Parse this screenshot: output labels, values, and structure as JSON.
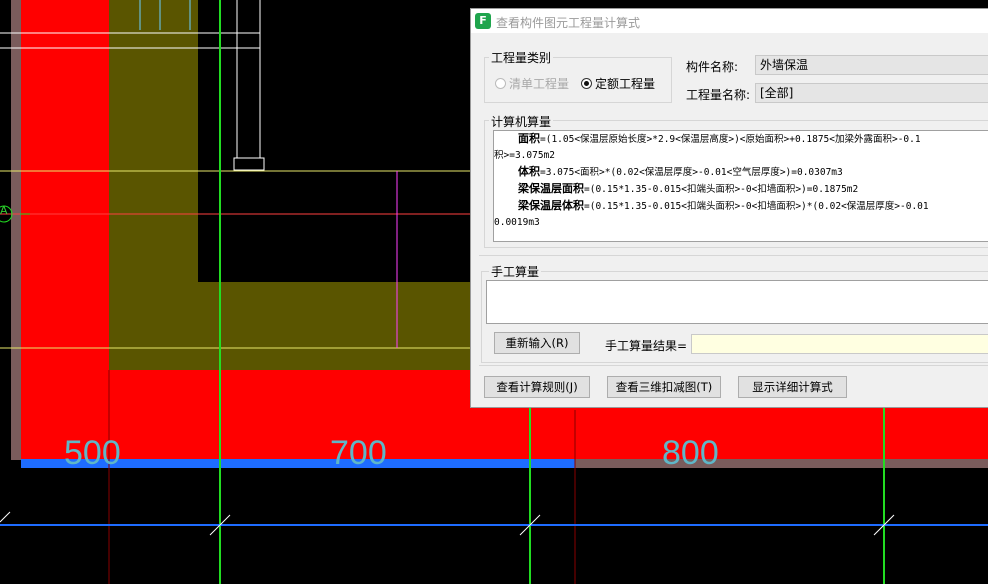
{
  "cad": {
    "dimensions": [
      "500",
      "700",
      "800"
    ],
    "axis_label": "A"
  },
  "dialog": {
    "title": "查看构件图元工程量计算式",
    "quantity_type_group": "工程量类别",
    "radio_list_quantity": "清单工程量",
    "radio_quota_quantity": "定额工程量",
    "radio_selected": "定额工程量",
    "component_name_label": "构件名称:",
    "component_name_value": "外墙保温",
    "quantity_name_label": "工程量名称:",
    "quantity_name_value": "[全部]",
    "computer_calc_group": "计算机算量",
    "calc_lines": [
      {
        "name": "面积",
        "expr": "=(1.05<保温层原始长度>*2.9<保温层高度>)<原始面积>+0.1875<加梁外露面积>-0.1",
        "indent": true
      },
      {
        "name": "",
        "expr": "积>=3.075m2",
        "indent": false
      },
      {
        "name": "体积",
        "expr": "=3.075<面积>*(0.02<保温层厚度>-0.01<空气层厚度>)=0.0307m3",
        "indent": true
      },
      {
        "name": "梁保温层面积",
        "expr": "=(0.15*1.35-0.015<扣端头面积>-0<扣墙面积>)=0.1875m2",
        "indent": true
      },
      {
        "name": "梁保温层体积",
        "expr": "=(0.15*1.35-0.015<扣端头面积>-0<扣墙面积>)*(0.02<保温层厚度>-0.01",
        "indent": true
      },
      {
        "name": "",
        "expr": "0.0019m3",
        "indent": false
      }
    ],
    "manual_calc_group": "手工算量",
    "reenter_button": "重新输入(R)",
    "manual_result_label": "手工算量结果=",
    "manual_result_value": "",
    "view_rules_button": "查看计算规则(J)",
    "view_3d_button": "查看三维扣减图(T)",
    "show_detail_button": "显示详细计算式"
  }
}
